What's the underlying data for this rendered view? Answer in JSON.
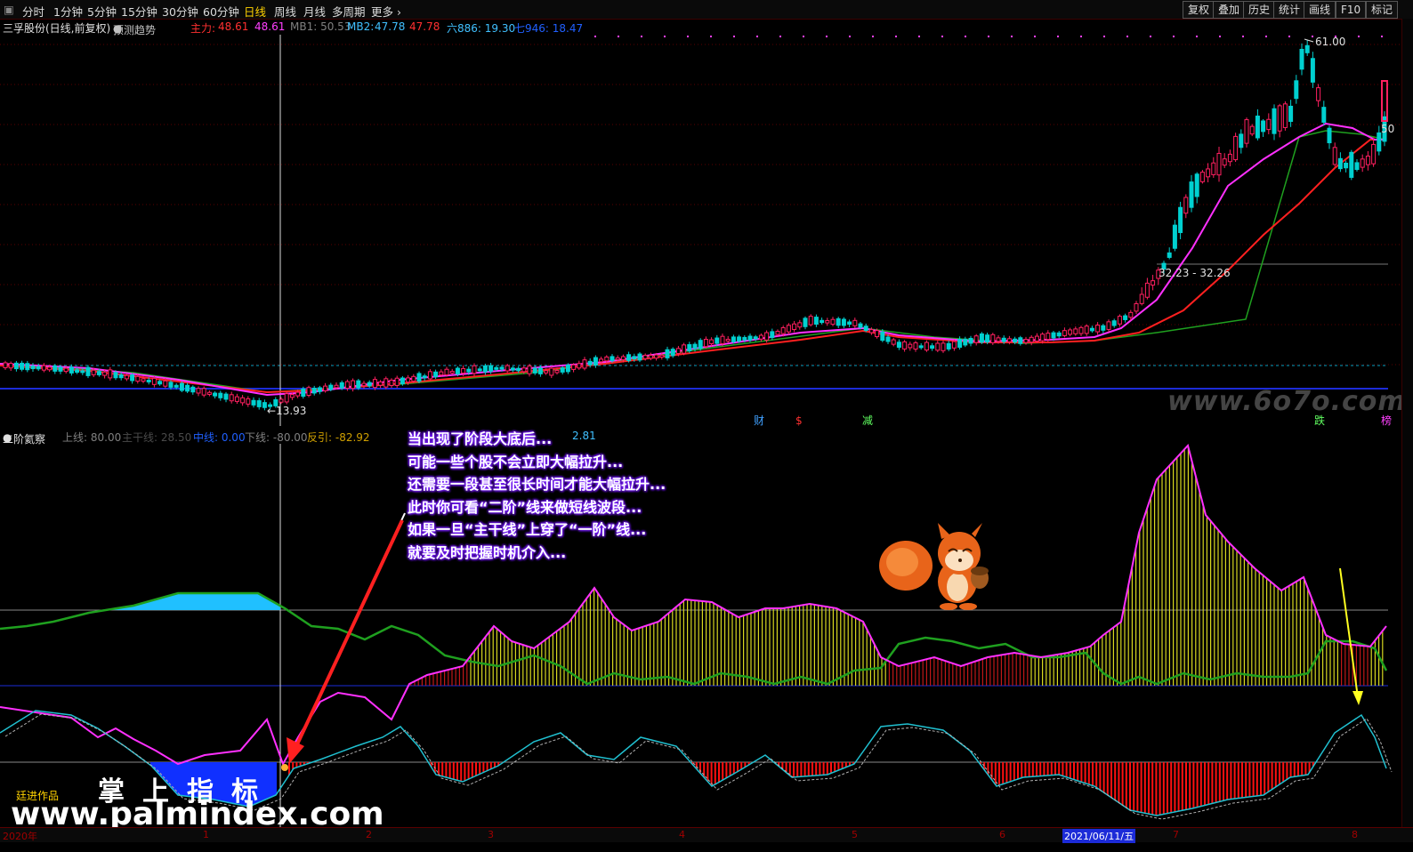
{
  "toolbar": {
    "periods": [
      "分时",
      "1分钟",
      "5分钟",
      "15分钟",
      "30分钟",
      "60分钟",
      "日线",
      "周线",
      "月线",
      "多周期",
      "更多"
    ],
    "active_period": "日线",
    "right_buttons": [
      "复权",
      "叠加",
      "历史",
      "统计",
      "画线",
      "F10",
      "标记"
    ]
  },
  "main_header": {
    "stock": "三孚股份(日线,前复权)",
    "forecast": "预测趋势",
    "zhuli_label": "主力:",
    "zhuli_v1": "48.61",
    "zhuli_v2": "48.61",
    "mb1": "MB1: 50.53",
    "mb2_label": "MB2:",
    "mb2_v1": "47.78",
    "mb2_v2": "47.78",
    "liu": "六886: 19.30",
    "qi": "七946: 18.47"
  },
  "main_chart": {
    "high_label": "61.00",
    "low_label": "13.93",
    "mid_label": "32.23 - 32.26",
    "right_label": "50",
    "markers": [
      "财",
      "$",
      "减",
      "跌",
      "榜"
    ]
  },
  "sub_header": {
    "name": "二阶氦察",
    "upper": "上线: 80.00",
    "zhugan": "主干线: 28.50",
    "mid": "中线: 0.00",
    "lower": "下线: -80.00",
    "fanyin": "反引: -82.92",
    "extra": "2.81"
  },
  "annotation": [
    "当出现了阶段大底后...",
    "可能一些个股不会立即大幅拉升...",
    "还需要一段甚至很长时间才能大幅拉升...",
    "此时你可看“二阶”线来做短线波段...",
    "如果一旦“主干线”上穿了“一阶”线...",
    "就要及时把握时机介入..."
  ],
  "watermarks": {
    "zhangshang": "掌上指标",
    "site": "www.palmindex.com",
    "author": "廷进作品",
    "site2": "www.6o7o.com"
  },
  "date_axis": {
    "labels": [
      "2020年",
      "1",
      "2",
      "3",
      "4",
      "5",
      "6",
      "7",
      "8"
    ],
    "selected": "2021/06/11/五"
  },
  "colors": {
    "accent": "#ffd200",
    "magenta": "#ff00ff",
    "red": "#ff2020",
    "green": "#1fa01f",
    "cyan": "#00ffff",
    "blue": "#1c2bd8"
  }
}
